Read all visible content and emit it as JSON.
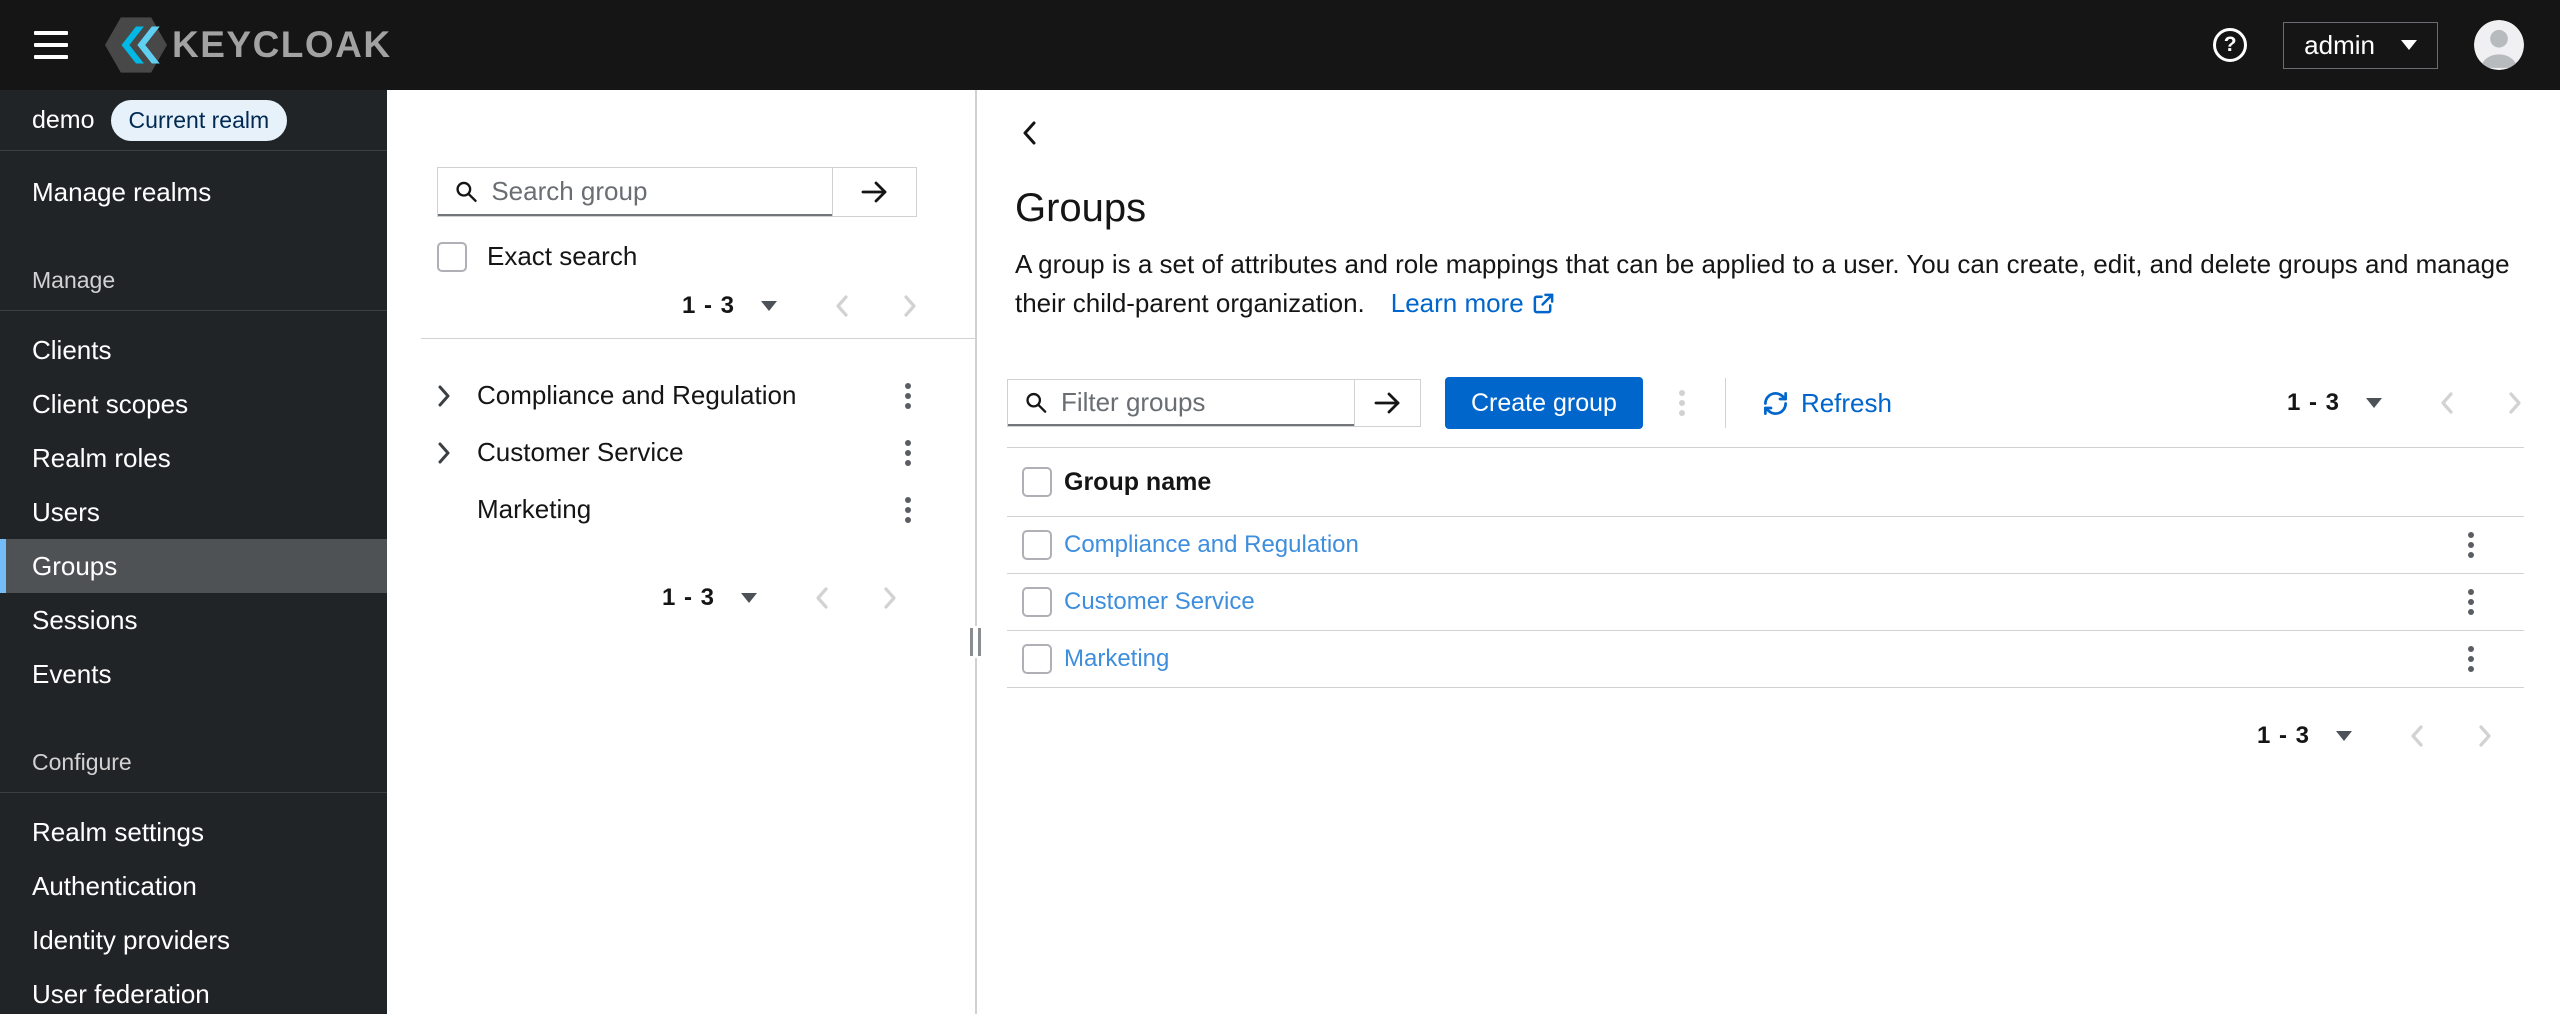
{
  "masthead": {
    "brand": "KEYCLOAK",
    "user_menu_label": "admin"
  },
  "icons": {
    "question_mark": "?"
  },
  "colors": {
    "masthead_bg": "#151515",
    "sidebar_bg": "#212427",
    "nav_selected_bg": "#4F5255",
    "nav_selected_border": "#73BCF7",
    "badge_bg": "#E7F1FA",
    "badge_text": "#002952",
    "accent": "#0066CC",
    "row_link": "#3E8EDE",
    "divider": "#D2D2D2",
    "muted_text": "#6A6E73",
    "disabled": "#D2D2D2"
  },
  "sidebar": {
    "realm": {
      "name": "demo",
      "badge": "Current realm"
    },
    "top_items": [
      {
        "label": "Manage realms"
      }
    ],
    "sections": [
      {
        "label": "Manage",
        "items": [
          {
            "label": "Clients",
            "selected": false
          },
          {
            "label": "Client scopes",
            "selected": false
          },
          {
            "label": "Realm roles",
            "selected": false
          },
          {
            "label": "Users",
            "selected": false
          },
          {
            "label": "Groups",
            "selected": true
          },
          {
            "label": "Sessions",
            "selected": false
          },
          {
            "label": "Events",
            "selected": false
          }
        ]
      },
      {
        "label": "Configure",
        "items": [
          {
            "label": "Realm settings",
            "selected": false
          },
          {
            "label": "Authentication",
            "selected": false
          },
          {
            "label": "Identity providers",
            "selected": false
          },
          {
            "label": "User federation",
            "selected": false
          }
        ]
      }
    ]
  },
  "group_tree_panel": {
    "search_placeholder": "Search group",
    "search_value": "",
    "exact_search_label": "Exact search",
    "exact_search_checked": false,
    "pagination_top": {
      "range": "1 - 3"
    },
    "items": [
      {
        "label": "Compliance and Regulation",
        "expandable": true
      },
      {
        "label": "Customer Service",
        "expandable": true
      },
      {
        "label": "Marketing",
        "expandable": false
      }
    ],
    "pagination_bottom": {
      "range": "1 - 3"
    }
  },
  "main": {
    "title": "Groups",
    "description": "A group is a set of attributes and role mappings that can be applied to a user. You can create, edit, and delete groups and manage their child-parent organization.",
    "learn_more_label": "Learn more",
    "toolbar": {
      "filter_placeholder": "Filter groups",
      "filter_value": "",
      "create_button_label": "Create group",
      "refresh_label": "Refresh",
      "pagination": {
        "range": "1 - 3"
      }
    },
    "table": {
      "header": "Group name",
      "rows": [
        {
          "name": "Compliance and Regulation",
          "selected": false
        },
        {
          "name": "Customer Service",
          "selected": false
        },
        {
          "name": "Marketing",
          "selected": false
        }
      ]
    },
    "pagination_bottom": {
      "range": "1 - 3"
    }
  }
}
